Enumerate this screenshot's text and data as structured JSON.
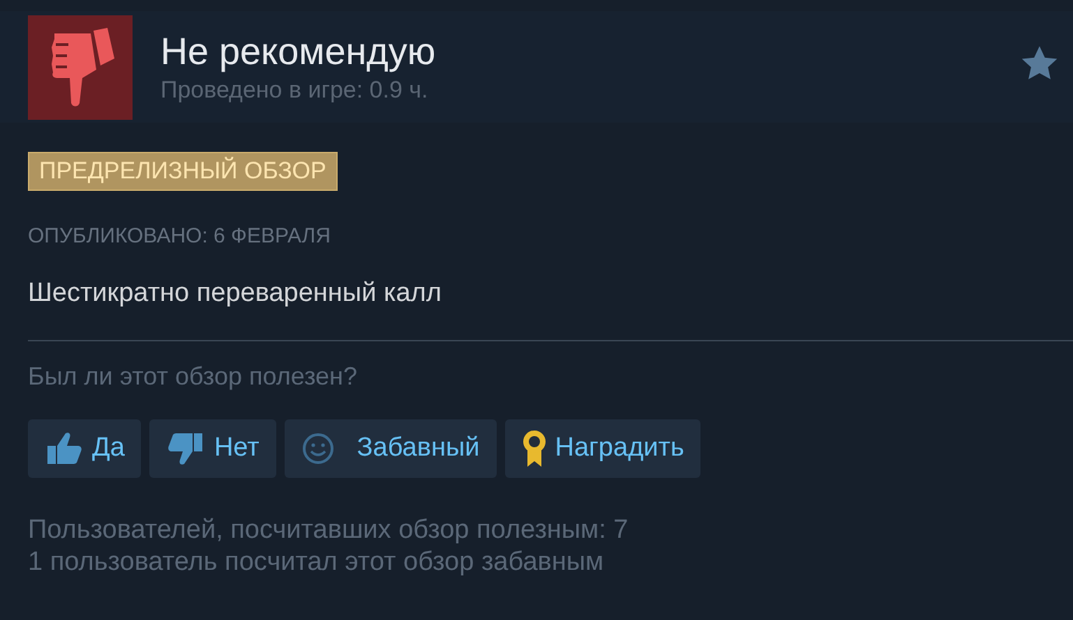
{
  "review": {
    "verdict": "Не рекомендую",
    "playtime": "Проведено в игре: 0.9 ч.",
    "badge": "ПРЕДРЕЛИЗНЫЙ ОБЗОР",
    "posted": "ОПУБЛИКОВАНО: 6 ФЕВРАЛЯ",
    "text": "Шестикратно переваренный калл"
  },
  "helpful": {
    "question": "Был ли этот обзор полезен?",
    "buttons": [
      {
        "kind": "thumbs-up",
        "label": "Да"
      },
      {
        "kind": "thumbs-down",
        "label": "Нет"
      },
      {
        "kind": "smile",
        "label": "Забавный"
      },
      {
        "kind": "award",
        "label": "Наградить"
      }
    ],
    "stats": [
      "Пользователей, посчитавших обзор полезным: 7",
      "1 пользователь посчитал этот обзор забавным"
    ]
  }
}
